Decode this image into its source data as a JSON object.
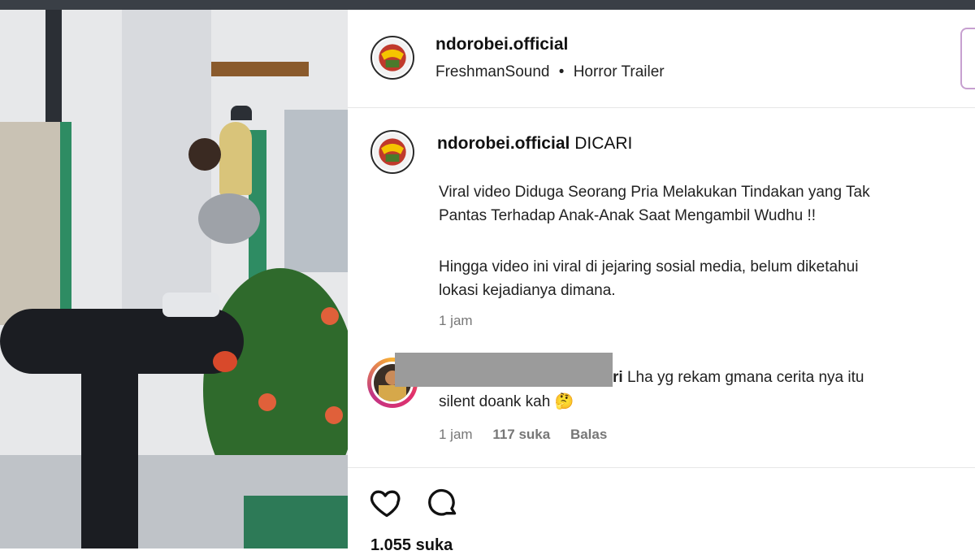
{
  "post": {
    "username": "ndorobei.official",
    "audio": "FreshmanSound",
    "separator": "•",
    "audio_title": "Horror Trailer"
  },
  "caption": {
    "username": "ndorobei.official",
    "headline": "DICARI",
    "paragraph1_line1": "Viral video Diduga Seorang Pria Melakukan Tindakan yang Tak",
    "paragraph1_line2": "Pantas Terhadap Anak-Anak Saat Mengambil Wudhu !!",
    "paragraph2_line1": "Hingga video ini viral di jejaring sosial media, belum diketahui",
    "paragraph2_line2": "lokasi kejadianya dimana.",
    "time": "1 jam"
  },
  "comment": {
    "username_tail": "ri",
    "text_line1": "Lha yg rekam gmana cerita nya itu",
    "text_line2": "silent doank kah 🤔",
    "time": "1 jam",
    "likes": "117 suka",
    "reply": "Balas"
  },
  "actions": {
    "like_icon": "heart-icon",
    "comment_icon": "comment-icon",
    "likes_count_partial": "1.055 suka"
  },
  "colors": {
    "story_ring": "#e1306c",
    "follow_edge": "#c7a0d0",
    "redaction": "#9b9b9b"
  }
}
